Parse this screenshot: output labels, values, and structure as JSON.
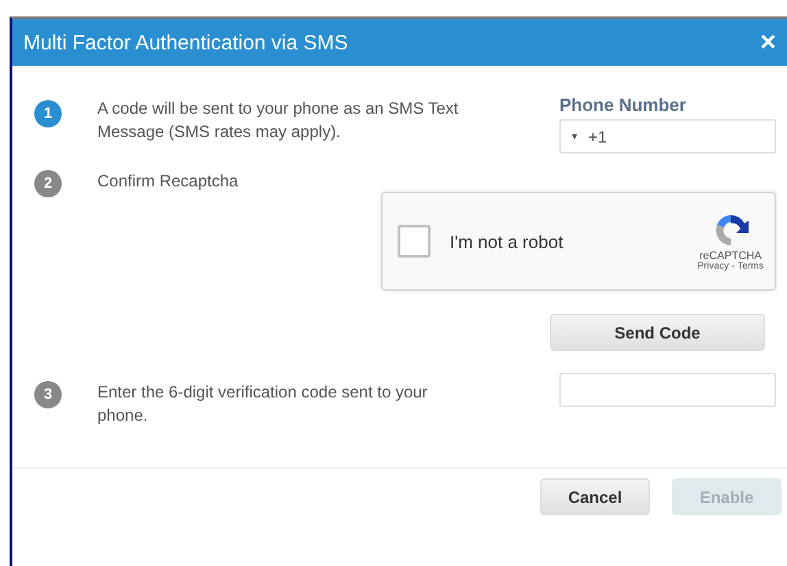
{
  "dialog": {
    "title": "Multi Factor Authentication via SMS",
    "close": "×"
  },
  "steps": [
    {
      "number": "1",
      "text": "A code will be sent to your phone as an SMS Text Message (SMS rates may apply).",
      "active": true,
      "kind": "phone"
    },
    {
      "number": "2",
      "text": "Confirm Recaptcha",
      "active": false,
      "kind": "captcha"
    },
    {
      "number": "3",
      "text": "Enter the 6-digit verification code sent to your phone.",
      "active": false,
      "kind": "code"
    }
  ],
  "phone": {
    "label": "Phone Number",
    "caret": "▾",
    "value": "+1"
  },
  "recaptcha": {
    "checked": false,
    "label": "I'm not a robot",
    "brand": "reCAPTCHA",
    "privacy": "Privacy",
    "separator": "-",
    "terms": "Terms"
  },
  "send_button": {
    "label": "Send Code",
    "disabled": false
  },
  "footer": [
    {
      "label": "Cancel",
      "disabled": false
    },
    {
      "label": "Enable",
      "disabled": true
    }
  ]
}
